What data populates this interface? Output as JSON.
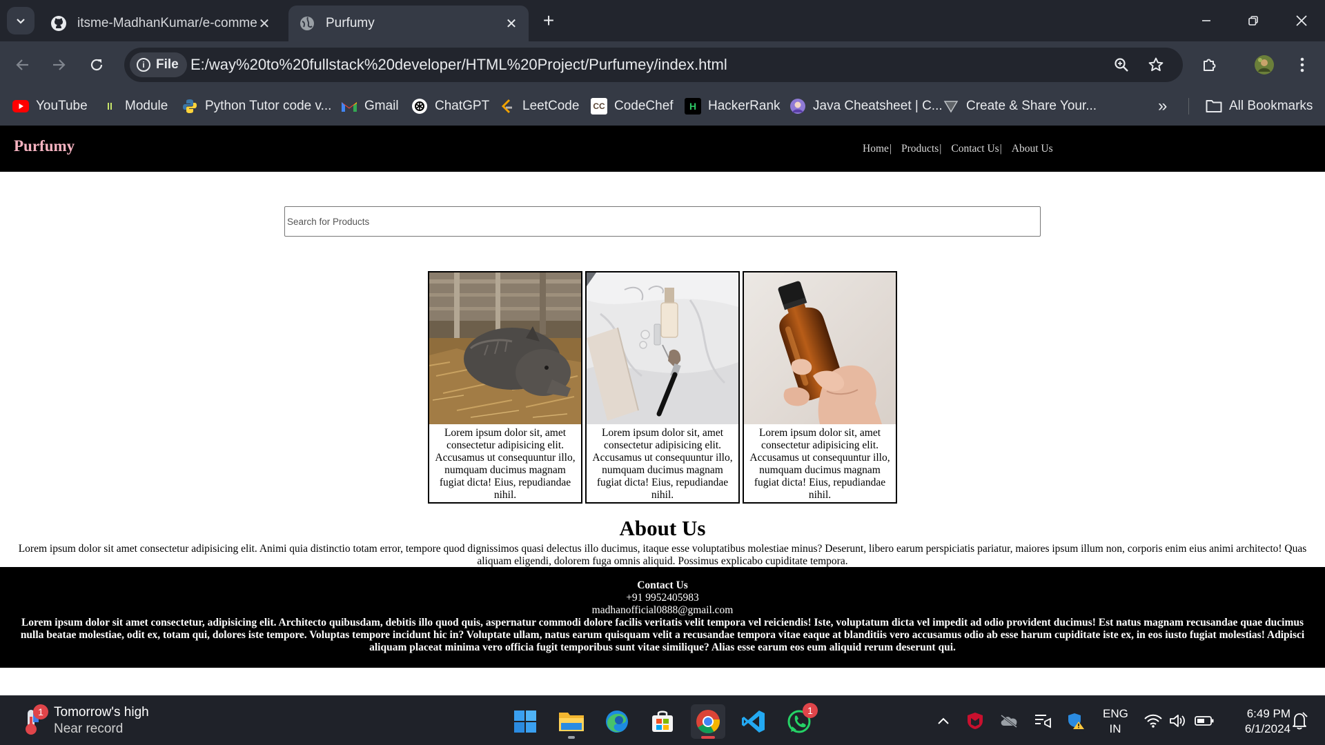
{
  "browser": {
    "tabs": [
      {
        "title": "itsme-MadhanKumar/e-comme",
        "icon": "github-icon",
        "active": false
      },
      {
        "title": "Purfumy",
        "icon": "globe-icon",
        "active": true
      }
    ],
    "site_chip": "File",
    "url": "E:/way%20to%20fullstack%20developer/HTML%20Project/Purfumey/index.html",
    "bookmarks": [
      {
        "label": "YouTube",
        "icon": "youtube-icon"
      },
      {
        "label": "Module",
        "icon": "module-icon"
      },
      {
        "label": "Python Tutor code v...",
        "icon": "python-icon"
      },
      {
        "label": "Gmail",
        "icon": "gmail-icon"
      },
      {
        "label": "ChatGPT",
        "icon": "chatgpt-icon"
      },
      {
        "label": "LeetCode",
        "icon": "leetcode-icon"
      },
      {
        "label": "CodeChef",
        "icon": "codechef-icon"
      },
      {
        "label": "HackerRank",
        "icon": "hackerrank-icon"
      },
      {
        "label": "Java Cheatsheet | C...",
        "icon": "java-avatar-icon"
      },
      {
        "label": "Create & Share Your...",
        "icon": "triangle-icon"
      }
    ],
    "all_bookmarks": "All Bookmarks",
    "codechef_icon_text": "CC",
    "hackerrank_icon_text": "H"
  },
  "site": {
    "brand": "Purfumy",
    "nav": [
      "Home",
      "Products",
      "Contact Us",
      "About Us"
    ],
    "nav_separator": "|",
    "search_placeholder": "Search for Products",
    "products": [
      {
        "image": "boar-in-straw",
        "description": "Lorem ipsum dolor sit, amet consectetur adipisicing elit. Accusamus ut consequuntur illo, numquam ducimus magnam fugiat dicta! Eius, repudiandae nihil."
      },
      {
        "image": "cosmetics-flatlay",
        "description": "Lorem ipsum dolor sit, amet consectetur adipisicing elit. Accusamus ut consequuntur illo, numquam ducimus magnam fugiat dicta! Eius, repudiandae nihil."
      },
      {
        "image": "amber-bottle-in-hand",
        "description": "Lorem ipsum dolor sit, amet consectetur adipisicing elit. Accusamus ut consequuntur illo, numquam ducimus magnam fugiat dicta! Eius, repudiandae nihil."
      }
    ],
    "about": {
      "title": "About Us",
      "text": "Lorem ipsum dolor sit amet consectetur adipisicing elit. Animi quia distinctio totam error, tempore quod dignissimos quasi delectus illo ducimus, itaque esse voluptatibus molestiae minus? Deserunt, libero earum perspiciatis pariatur, maiores ipsum illum non, corporis enim eius animi architecto! Quas aliquam eligendi, dolorem fuga omnis aliquid. Possimus explicabo cupiditate tempora."
    },
    "footer": {
      "title": "Contact Us",
      "phone": "+91 9952405983",
      "email": "madhanofficial0888@gmail.com",
      "text": "Lorem ipsum dolor sit amet consectetur, adipisicing elit. Architecto quibusdam, debitis illo quod quis, aspernatur commodi dolore facilis veritatis velit tempora vel reiciendis! Iste, voluptatum dicta vel impedit ad odio provident ducimus! Est natus magnam recusandae quae ducimus nulla beatae molestiae, odit ex, totam qui, dolores iste tempore. Voluptas tempore incidunt hic in? Voluptate ullam, natus earum quisquam velit a recusandae tempora vitae eaque at blanditiis vero accusamus odio ab esse harum cupiditate iste ex, in eos iusto fugiat molestias! Adipisci aliquam placeat minima vero officia fugit temporibus sunt vitae similique? Alias esse earum eos eum aliquid rerum deserunt qui."
    }
  },
  "taskbar": {
    "weather_line1": "Tomorrow's high",
    "weather_line2": "Near record",
    "weather_badge": "1",
    "whatsapp_badge": "1",
    "lang_line1": "ENG",
    "lang_line2": "IN",
    "time": "6:49 PM",
    "date": "6/1/2024"
  },
  "colors": {
    "brand": "#f6b3c1",
    "nav_bg": "#000000",
    "chrome_bg": "#353a45",
    "tabstrip_bg": "#22252d"
  }
}
